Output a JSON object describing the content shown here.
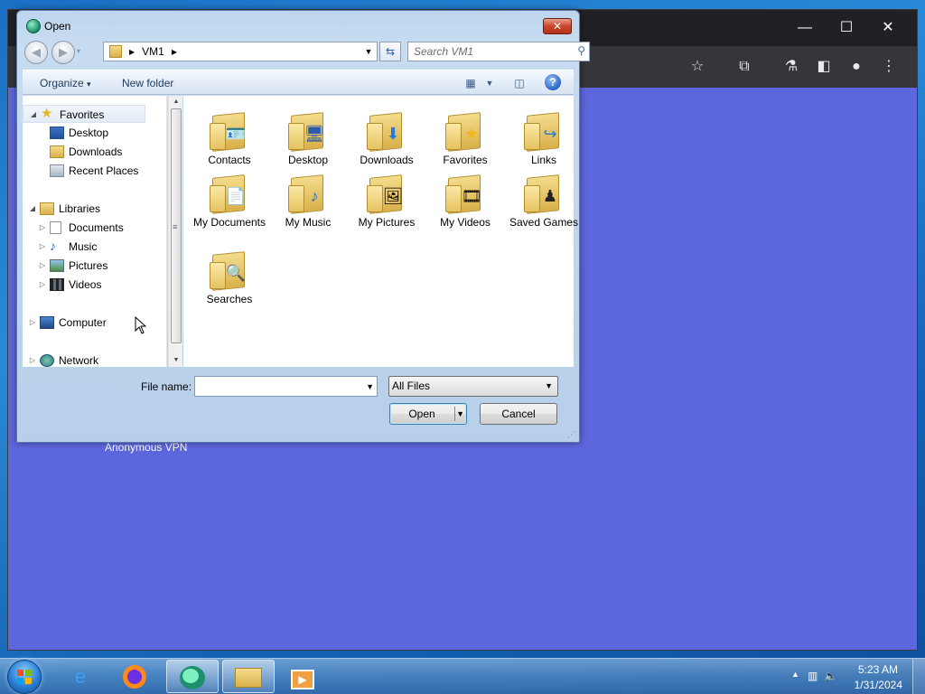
{
  "dialog": {
    "title": "Open",
    "close_label": "✕",
    "address": {
      "crumbs": [
        "VM1"
      ]
    },
    "search_placeholder": "Search VM1",
    "commands": {
      "organize": "Organize",
      "organize_caret": "▾",
      "new_folder": "New folder",
      "help": "?"
    },
    "nav": {
      "favorites": "Favorites",
      "desktop": "Desktop",
      "downloads": "Downloads",
      "recent_places": "Recent Places",
      "libraries": "Libraries",
      "documents": "Documents",
      "music": "Music",
      "pictures": "Pictures",
      "videos": "Videos",
      "computer": "Computer",
      "network": "Network"
    },
    "folders": [
      {
        "name": "Contacts",
        "icon": "contact-card-icon"
      },
      {
        "name": "Desktop",
        "icon": "monitor-icon"
      },
      {
        "name": "Downloads",
        "icon": "down-arrow-icon"
      },
      {
        "name": "Favorites",
        "icon": "star-icon"
      },
      {
        "name": "Links",
        "icon": "link-arrow-icon"
      },
      {
        "name": "My Documents",
        "icon": "document-icon"
      },
      {
        "name": "My Music",
        "icon": "music-note-icon"
      },
      {
        "name": "My Pictures",
        "icon": "picture-icon"
      },
      {
        "name": "My Videos",
        "icon": "film-icon"
      },
      {
        "name": "Saved Games",
        "icon": "chess-piece-icon"
      },
      {
        "name": "Searches",
        "icon": "magnifier-icon"
      }
    ],
    "file_name_label": "File name:",
    "file_name_value": "",
    "filter_value": "All Files",
    "open_label": "Open",
    "cancel_label": "Cancel"
  },
  "background": {
    "vpn_label": "Anonymous VPN",
    "accent": "#5d67dd"
  },
  "taskbar": {
    "time": "5:23 AM",
    "date": "1/31/2024",
    "apps": [
      "internet-explorer-icon",
      "firefox-icon",
      "vpn-app-icon",
      "file-explorer-icon",
      "media-player-icon"
    ]
  }
}
